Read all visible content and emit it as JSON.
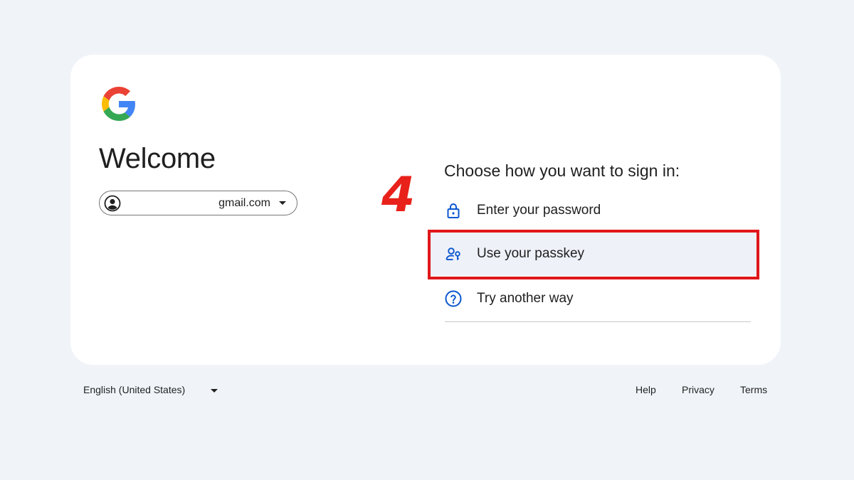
{
  "card": {
    "logo_icon": "google-g-logo",
    "heading": "Welcome",
    "account": {
      "email": "gmail.com",
      "avatar_icon": "account-circle-icon",
      "dropdown_icon": "caret-down-icon"
    },
    "step_marker": "4",
    "prompt": "Choose how you want to sign in:",
    "options": [
      {
        "label": "Enter your password",
        "icon": "lock-icon"
      },
      {
        "label": "Use your passkey",
        "icon": "passkey-icon",
        "highlighted": true
      },
      {
        "label": "Try another way",
        "icon": "help-circle-icon"
      }
    ]
  },
  "footer": {
    "language": "English (United States)",
    "links": [
      "Help",
      "Privacy",
      "Terms"
    ]
  },
  "colors": {
    "background": "#f0f4f9",
    "card": "#ffffff",
    "accent_blue": "#0b57d0",
    "highlight_red": "#e0161a"
  }
}
